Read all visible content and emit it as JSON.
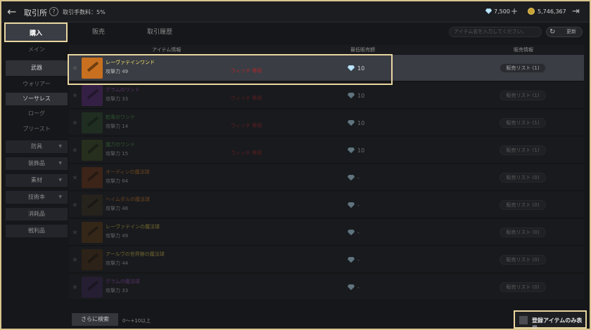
{
  "header": {
    "title": "取引所",
    "help": "?",
    "fee": "取引手数料：5%",
    "gems": "7,500",
    "plus": "+",
    "gold": "5,746,367"
  },
  "tabs": [
    {
      "label": "購入"
    },
    {
      "label": "販売"
    },
    {
      "label": "取引履歴"
    }
  ],
  "search": {
    "placeholder": "アイテム名を入力してください。",
    "refresh": "更新"
  },
  "sidebar": [
    {
      "label": "メイン"
    },
    {
      "label": "武器"
    },
    {
      "label": "ウォリアー"
    },
    {
      "label": "ソーサレス"
    },
    {
      "label": "ローグ"
    },
    {
      "label": "プリースト"
    },
    {
      "label": "防具"
    },
    {
      "label": "装飾品"
    },
    {
      "label": "素材"
    },
    {
      "label": "技術本"
    },
    {
      "label": "消耗品"
    },
    {
      "label": "戦利品"
    }
  ],
  "table": {
    "headers": {
      "info": "アイテム情報",
      "price": "最低販売額",
      "sale": "販売情報"
    },
    "rows": [
      {
        "name": "レーヴァテインワンド",
        "stat": "攻撃力 49",
        "restrict": "ウィッチ 専用",
        "price": "10",
        "sell": "販売リスト (1)",
        "name_color": "#f1e06a",
        "thumb": "#c8701f"
      },
      {
        "name": "グラムのワンド",
        "stat": "攻撃力 33",
        "restrict": "ウィッチ 専用",
        "price": "10",
        "sell": "販売リスト (1)",
        "name_color": "#a050c8",
        "thumb": "#5b2a7a"
      },
      {
        "name": "蛇毒のワンド",
        "stat": "攻撃力 14",
        "restrict": "ウィッチ 専用",
        "price": "10",
        "sell": "販売リスト (1)",
        "name_color": "#46a04b",
        "thumb": "#2a4a2a"
      },
      {
        "name": "魔力のワンド",
        "stat": "攻撃力 15",
        "restrict": "ウィッチ 専用",
        "price": "10",
        "sell": "販売リスト (1)",
        "name_color": "#46a04b",
        "thumb": "#3a4a22"
      },
      {
        "name": "オーディンの魔法球",
        "stat": "攻撃力 64",
        "restrict": "",
        "price": "-",
        "sell": "販売リスト (0)",
        "name_color": "#d07a2a",
        "thumb": "#6a3418"
      },
      {
        "name": "ヘイムダルの魔法球",
        "stat": "攻撃力 48",
        "restrict": "",
        "price": "-",
        "sell": "販売リスト (0)",
        "name_color": "#d07a2a",
        "thumb": "#3a3020"
      },
      {
        "name": "レーヴァテインの魔法球",
        "stat": "攻撃力 49",
        "restrict": "",
        "price": "-",
        "sell": "販売リスト (0)",
        "name_color": "#d9c24a",
        "thumb": "#5a3a18"
      },
      {
        "name": "アールヴの世界樹の魔法球",
        "stat": "攻撃力 44",
        "restrict": "",
        "price": "-",
        "sell": "販売リスト (0)",
        "name_color": "#d9c24a",
        "thumb": "#4a3018"
      },
      {
        "name": "グラムの魔法球",
        "stat": "攻撃力 33",
        "restrict": "",
        "price": "-",
        "sell": "販売リスト (0)",
        "name_color": "#a050c8",
        "thumb": "#3a2650"
      }
    ]
  },
  "footer": {
    "more": "さらに検索",
    "range": "0～+10以上",
    "show_registered": "登録アイテムのみ表示"
  }
}
